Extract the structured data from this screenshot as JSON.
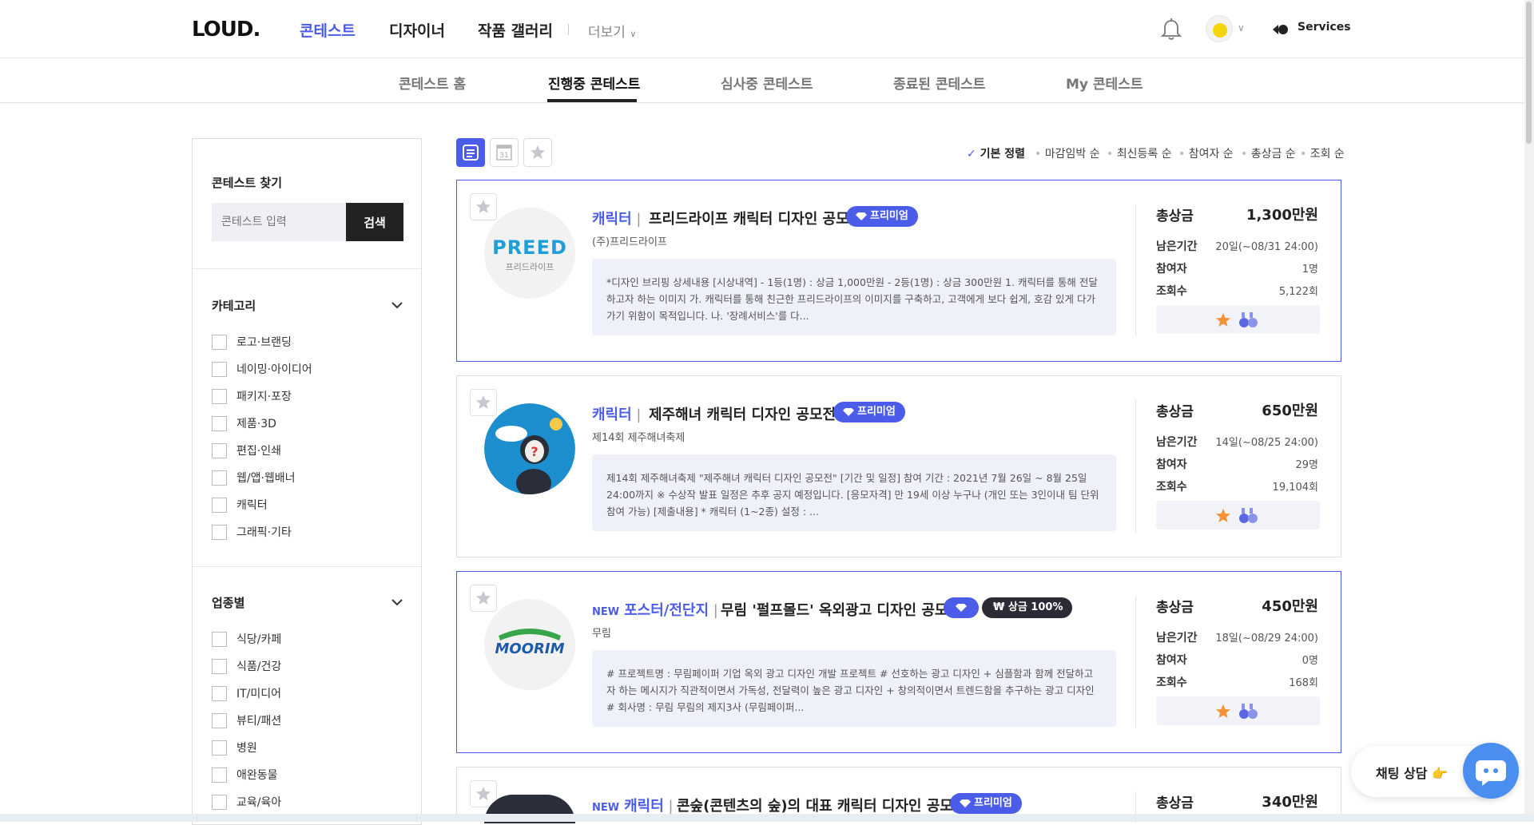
{
  "header": {
    "logo": "LOUD.",
    "nav": [
      "콘테스트",
      "디자이너",
      "작품 갤러리"
    ],
    "more": "더보기",
    "services": "Services"
  },
  "subnav": [
    "콘테스트 홈",
    "진행중 콘테스트",
    "심사중 콘테스트",
    "종료된 콘테스트",
    "My 콘테스트"
  ],
  "sidebar": {
    "search_title": "콘테스트 찾기",
    "search_placeholder": "콘테스트 입력",
    "search_button": "검색",
    "category_title": "카테고리",
    "categories": [
      "로고·브랜딩",
      "네이밍·아이디어",
      "패키지·포장",
      "제품·3D",
      "편집·인쇄",
      "웹/앱·웹배너",
      "캐릭터",
      "그래픽·기타"
    ],
    "industry_title": "업종별",
    "industries": [
      "식당/카페",
      "식품/건강",
      "IT/미디어",
      "뷰티/패션",
      "병원",
      "애완동물",
      "교육/육아"
    ]
  },
  "sort": {
    "options": [
      "기본 정렬",
      "마감임박 순",
      "최신등록 순",
      "참여자 순",
      "총상금 순",
      "조회 순"
    ]
  },
  "labels": {
    "prize": "총상금",
    "remain": "남은기간",
    "participants": "참여자",
    "views": "조회수"
  },
  "cards": [
    {
      "category": "캐릭터",
      "title": "프리드라이프 캐릭터 디자인 공모",
      "badge": "프리미엄",
      "org": "(주)프리드라이프",
      "desc": "*디자인 브리핑 상세내용 [시상내역] - 1등(1명) : 상금 1,000만원 - 2등(1명) : 상금 300만원 1. 캐릭터를 통해 전달하고자 하는 이미지 가. 캐릭터를 통해 친근한 프리드라이프의 이미지를 구축하고, 고객에게 보다 쉽게, 호감 있게 다가가기 위함이 목적입니다. 나. '장례서비스'를 다...",
      "prize": "1,300만원",
      "remain": "20일(~08/31 24:00)",
      "participants": "1명",
      "views": "5,122회",
      "thumb_text": "PREED",
      "thumb_sub": "프리드라이프"
    },
    {
      "category": "캐릭터",
      "title": "제주해녀 캐릭터 디자인 공모전",
      "badge": "프리미엄",
      "org": "제14회 제주해녀축제",
      "desc": "제14회 제주해녀축제 \"제주해녀 캐릭터 디자인 공모전\" [기간 및 일정] 참여 기간 : 2021년 7월 26일 ~ 8월 25일 24:00까지 ※ 수상작 발표 일정은 추후 공지 예정입니다. [응모자격] 만 19세 이상 누구나 (개인 또는 3인이내 팀 단위 참여 가능) [제출내용] * 캐릭터 (1~2종) 설정 : ...",
      "prize": "650만원",
      "remain": "14일(~08/25 24:00)",
      "participants": "29명",
      "views": "19,104회"
    },
    {
      "new": "NEW",
      "category": "포스터/전단지",
      "title": "무림 '펄프몰드' 옥외광고 디자인 공모",
      "badge2": "₩ 상금 100%",
      "org": "무림",
      "desc": "# 프로젝트명 : 무림페이퍼 기업 옥외 광고 디자인 개발 프로젝트 # 선호하는 광고 디자인 + 심플함과 함께 전달하고자 하는 메시지가 직관적이면서 가독성, 전달력이 높은 광고 디자인 + 창의적이면서 트렌드함을 추구하는 광고 디자인 # 회사명 : 무림 무림의 제지3사 (무림페이퍼...",
      "prize": "450만원",
      "remain": "18일(~08/29 24:00)",
      "participants": "0명",
      "views": "168회",
      "thumb_text": "MOORIM"
    },
    {
      "new": "NEW",
      "category": "캐릭터",
      "title": "콘숲(콘텐츠의 숲)의 대표 캐릭터 디자인 공모",
      "badge": "프리미엄",
      "prize": "340만원"
    }
  ],
  "chat": {
    "label": "채팅 상담"
  },
  "colors": {
    "accent": "#4a5ce8",
    "dark": "#222222",
    "desc_bg": "#eef1f9",
    "chat": "#4a8ef0"
  }
}
